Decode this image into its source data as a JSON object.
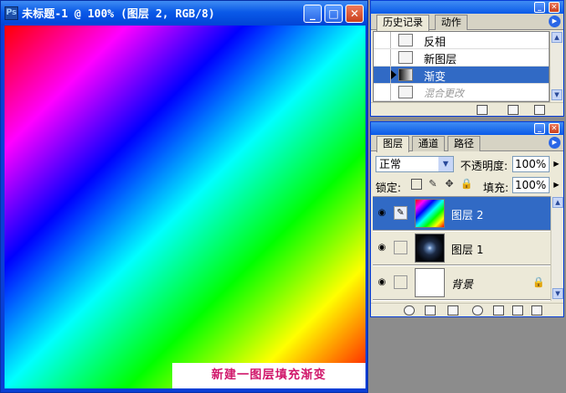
{
  "document": {
    "title": "未标题-1 @ 100% (图层 2, RGB/8)",
    "caption": "新建一图层填充渐变",
    "buttons": {
      "minimize": "_",
      "maximize": "□",
      "close": "✕"
    }
  },
  "history_palette": {
    "tabs": [
      "历史记录",
      "动作"
    ],
    "items": [
      {
        "label": "反相",
        "icon": "step-icon",
        "state": "normal"
      },
      {
        "label": "新图层",
        "icon": "step-icon",
        "state": "normal"
      },
      {
        "label": "渐变",
        "icon": "gradient-step-icon",
        "state": "selected"
      },
      {
        "label": "混合更改",
        "icon": "step-icon",
        "state": "disabled"
      }
    ]
  },
  "layers_palette": {
    "tabs": [
      "图层",
      "通道",
      "路径"
    ],
    "blend_mode": "正常",
    "opacity_label": "不透明度:",
    "opacity": "100%",
    "lock_label": "锁定:",
    "fill_label": "填充:",
    "fill": "100%",
    "layers": [
      {
        "name": "图层 2",
        "selected": true,
        "thumbnail": "rainbow-gradient"
      },
      {
        "name": "图层 1",
        "selected": false,
        "thumbnail": "galaxy"
      },
      {
        "name": "背景",
        "selected": false,
        "thumbnail": "white",
        "locked": true
      }
    ]
  },
  "colors": {
    "titlebar": "#0a5ae8",
    "selection": "#316ac5",
    "caption_text": "#d0166a",
    "palette_bg": "#ece9d8",
    "workspace": "#8c8c8c"
  }
}
